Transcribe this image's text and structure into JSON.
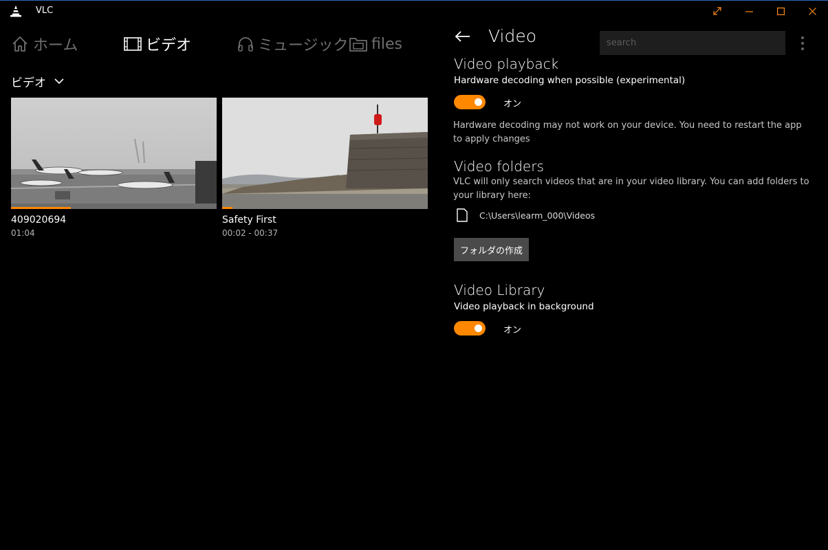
{
  "window": {
    "title": "VLC",
    "accent": "#ff8800",
    "controls": [
      "expand-icon",
      "minimize-icon",
      "maximize-icon",
      "close-icon"
    ]
  },
  "nav": {
    "items": [
      {
        "label": "ホーム",
        "icon": "home-icon",
        "active": false
      },
      {
        "label": "ビデオ",
        "icon": "film-icon",
        "active": true
      },
      {
        "label": "ミュージック",
        "icon": "headphones-icon",
        "active": false
      },
      {
        "label": "files",
        "icon": "folder-icon",
        "active": false
      }
    ]
  },
  "library": {
    "section_label": "ビデオ",
    "videos": [
      {
        "title": "409020694",
        "subtitle": "01:04",
        "progress": 0.29
      },
      {
        "title": "Safety First",
        "subtitle": "00:02 - 00:37",
        "progress": 0.05
      }
    ]
  },
  "settings": {
    "title": "Video",
    "search_placeholder": "search",
    "playback": {
      "heading": "Video playback",
      "hw_label": "Hardware decoding when possible (experimental)",
      "hw_state": "オン",
      "hw_note": "Hardware decoding may not work on your device. You need to restart the app to apply changes"
    },
    "folders": {
      "heading": "Video folders",
      "description": "VLC will only search videos that are in your video library. You can add folders to your library here:",
      "path": "C:\\Users\\learm_000\\Videos",
      "create_button": "フォルダの作成"
    },
    "library": {
      "heading": "Video Library",
      "bg_label": "Video playback in background",
      "bg_state": "オン"
    }
  }
}
